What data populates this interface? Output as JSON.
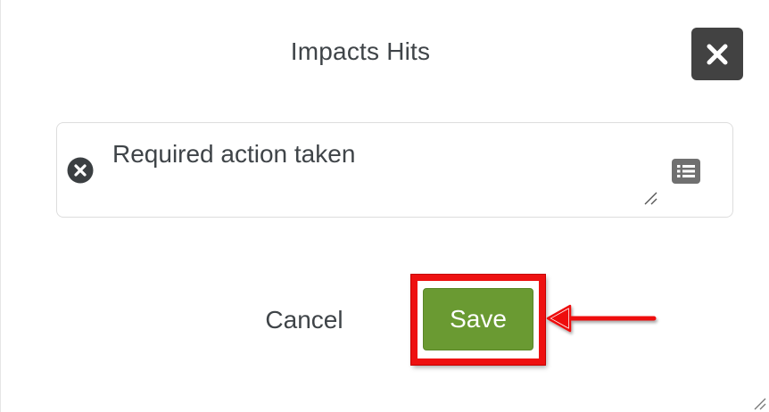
{
  "dialog": {
    "title": "Impacts Hits",
    "close_icon": "close-x-icon"
  },
  "field": {
    "value": "Required action taken",
    "clear_icon": "clear-circle-x-icon",
    "list_icon": "list-icon"
  },
  "actions": {
    "cancel_label": "Cancel",
    "save_label": "Save"
  },
  "colors": {
    "save_bg": "#6a9a32",
    "close_bg": "#424242",
    "highlight": "#ee1111",
    "text": "#3f4448"
  }
}
